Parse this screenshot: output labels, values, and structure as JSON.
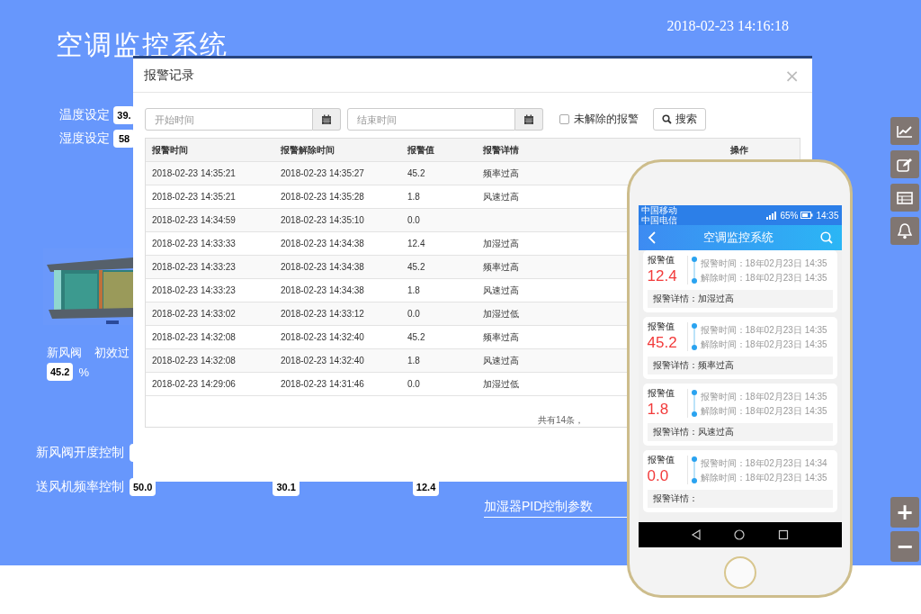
{
  "page": {
    "title": "空调监控系统",
    "datetime": "2018-02-23 14:16:18",
    "settings": [
      {
        "label": "温度设定",
        "value": "39."
      },
      {
        "label": "湿度设定",
        "value": "58"
      }
    ],
    "equipment_labels": [
      "新风阀",
      "初效过"
    ],
    "damper": {
      "value": "45.2",
      "unit": "%"
    },
    "controls": [
      {
        "label": "新风阀开度控制"
      },
      {
        "label": "送风机频率控制",
        "value": "50.0"
      }
    ],
    "other_values": [
      "30.1",
      "12.4"
    ],
    "link": "加湿器PID控制参数"
  },
  "zoom_buttons": [
    "+",
    "−"
  ],
  "modal": {
    "title": "报警记录",
    "close": "×",
    "filters": {
      "start_placeholder": "开始时间",
      "end_placeholder": "结束时间",
      "unresolved_label": "未解除的报警",
      "unresolved_checked": false,
      "search_label": "搜索"
    },
    "columns": [
      "报警时间",
      "报警解除时间",
      "报警值",
      "报警详情",
      "操作"
    ],
    "rows": [
      {
        "time": "2018-02-23 14:35:21",
        "cleared": "2018-02-23 14:35:27",
        "value": "45.2",
        "detail": "频率过高"
      },
      {
        "time": "2018-02-23 14:35:21",
        "cleared": "2018-02-23 14:35:28",
        "value": "1.8",
        "detail": "风速过高"
      },
      {
        "time": "2018-02-23 14:34:59",
        "cleared": "2018-02-23 14:35:10",
        "value": "0.0"
      },
      {
        "time": "2018-02-23 14:33:33",
        "cleared": "2018-02-23 14:34:38",
        "value": "12.4",
        "detail": "加湿过高"
      },
      {
        "time": "2018-02-23 14:33:23",
        "cleared": "2018-02-23 14:34:38",
        "value": "45.2",
        "detail": "频率过高"
      },
      {
        "time": "2018-02-23 14:33:23",
        "cleared": "2018-02-23 14:34:38",
        "value": "1.8",
        "detail": "风速过高"
      },
      {
        "time": "2018-02-23 14:33:02",
        "cleared": "2018-02-23 14:33:12",
        "value": "0.0",
        "detail": "加湿过低"
      },
      {
        "time": "2018-02-23 14:32:08",
        "cleared": "2018-02-23 14:32:40",
        "value": "45.2",
        "detail": "频率过高"
      },
      {
        "time": "2018-02-23 14:32:08",
        "cleared": "2018-02-23 14:32:40",
        "value": "1.8",
        "detail": "风速过高"
      },
      {
        "time": "2018-02-23 14:29:06",
        "cleared": "2018-02-23 14:31:46",
        "value": "0.0",
        "detail": "加湿过低"
      }
    ],
    "footer": "共有14条，"
  },
  "phone": {
    "status": {
      "carriers": [
        "中国移动",
        "中国电信"
      ],
      "battery": "65%",
      "time": "14:35"
    },
    "title": "空调监控系统",
    "cards": [
      {
        "value_label": "报警值",
        "value": "12.4",
        "alarm_time": "报警时间：18年02月23日 14:35",
        "clear_time": "解除时间：18年02月23日 14:35",
        "detail": "报警详情：加湿过高"
      },
      {
        "value_label": "报警值",
        "value": "45.2",
        "alarm_time": "报警时间：18年02月23日 14:35",
        "clear_time": "解除时间：18年02月23日 14:35",
        "detail": "报警详情：频率过高"
      },
      {
        "value_label": "报警值",
        "value": "1.8",
        "alarm_time": "报警时间：18年02月23日 14:35",
        "clear_time": "解除时间：18年02月23日 14:35",
        "detail": "报警详情：风速过高"
      },
      {
        "value_label": "报警值",
        "value": "0.0",
        "alarm_time": "报警时间：18年02月23日 14:34",
        "clear_time": "解除时间：18年02月23日 14:35",
        "detail": "报警详情："
      }
    ]
  }
}
